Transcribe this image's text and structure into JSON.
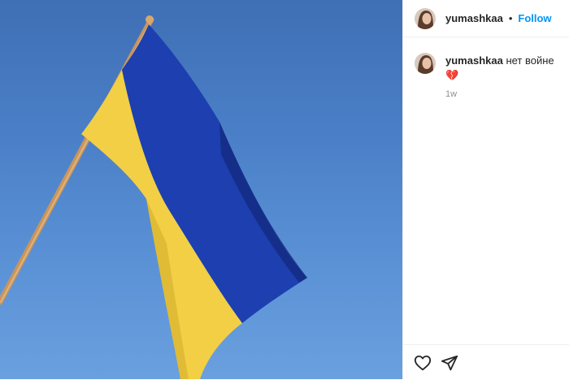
{
  "post": {
    "username": "yumashkaa",
    "separator": "•",
    "follow_label": "Follow"
  },
  "comment": {
    "username": "yumashkaa",
    "text": "нет войне",
    "emoji": "💔",
    "time": "1w"
  },
  "actions": {
    "like_icon": "heart-icon",
    "share_icon": "paper-plane-icon"
  },
  "colors": {
    "follow": "#0095f6",
    "flag_blue": "#1d3fb0",
    "flag_yellow": "#f2cf45"
  }
}
